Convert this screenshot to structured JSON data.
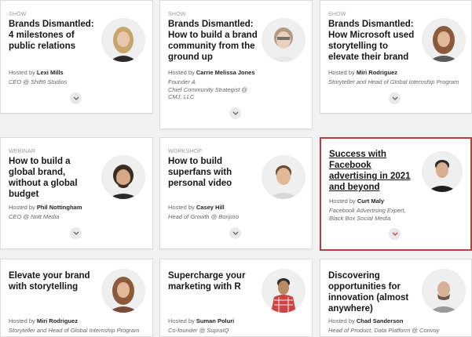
{
  "cards": [
    {
      "tag": "SHOW",
      "title": "Brands Dismantled: 4 milestones of public relations",
      "host_prefix": "Hosted by",
      "host_name": "Lexi Mills",
      "role": "CEO @ Shift6 Studios",
      "icon": "chevron-down-icon"
    },
    {
      "tag": "SHOW",
      "title": "Brands Dismantled: How to build a brand community from the ground up",
      "host_prefix": "Hosted by",
      "host_name": "Carrie Melissa Jones",
      "role_lines": [
        "Founder &",
        "Chief Community Strategist @",
        "CMJ, LLC"
      ],
      "icon": "chevron-down-icon"
    },
    {
      "tag": "SHOW",
      "title": "Brands Dismantled: How Microsoft used storytelling to elevate their brand",
      "host_prefix": "Hosted by",
      "host_name": "Miri Rodriguez",
      "role": "Storyteller and Head of Global Internship Program",
      "icon": "chevron-down-icon"
    },
    {
      "tag": "WEBINAR",
      "title": "How to build a global brand, without a global budget",
      "host_prefix": "Hosted by",
      "host_name": "Phil Nottingham",
      "role": "CEO @ Nott Media",
      "icon": "chevron-down-icon"
    },
    {
      "tag": "WORKSHOP",
      "title": "How to build superfans with personal video",
      "host_prefix": "Hosted by",
      "host_name": "Casey Hill",
      "role": "Head of Growth @ Bonjoro",
      "icon": "chevron-down-icon"
    },
    {
      "tag": "",
      "title": "Success with Facebook advertising in 2021 and beyond",
      "host_prefix": "Hosted by",
      "host_name": "Curt Maly",
      "role_lines": [
        "Facebook Advertising Expert,",
        "Black Box Social Media"
      ],
      "icon": "chevron-down-icon",
      "accent": "#c0393e"
    },
    {
      "tag": "",
      "title": "Elevate your brand with storytelling",
      "host_prefix": "Hosted by",
      "host_name": "Miri Rodriguez",
      "role": "Storyteller and Head of Global Internship Program"
    },
    {
      "tag": "",
      "title": "Supercharge your marketing with R",
      "host_prefix": "Hosted by",
      "host_name": "Suman Poluri",
      "role": "Co-founder @ SupraIQ"
    },
    {
      "tag": "",
      "title": "Discovering opportunities for innovation (almost anywhere)",
      "host_prefix": "Hosted by",
      "host_name": "Chad Sanderson",
      "role": "Head of Product, Data Platform @ Convoy"
    }
  ],
  "colors": {
    "accent": "#c0393e",
    "background": "#f2f2f2"
  }
}
